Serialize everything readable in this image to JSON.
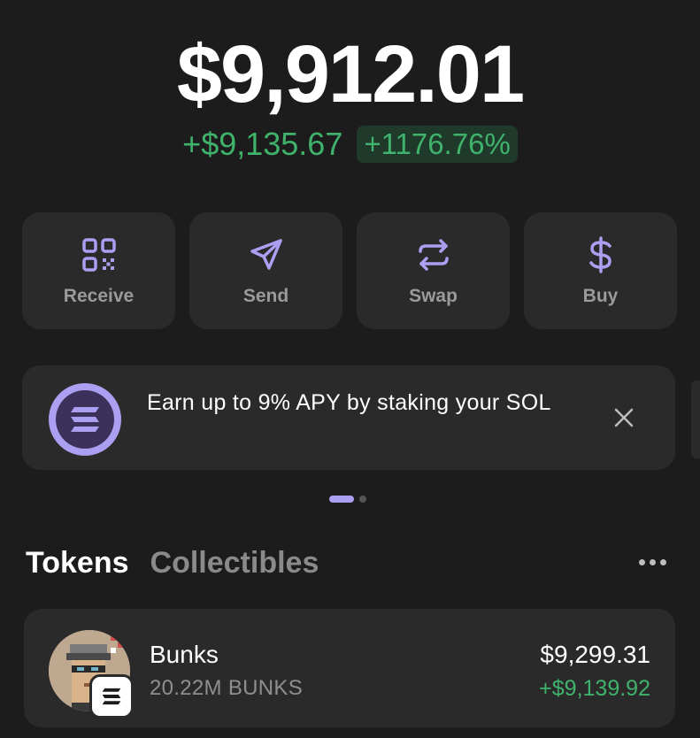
{
  "balance": {
    "total": "$9,912.01",
    "change_abs": "+$9,135.67",
    "change_pct": "+1176.76%"
  },
  "colors": {
    "background": "#1c1c1c",
    "card": "#2a2a2a",
    "accent": "#ab9ff2",
    "positive": "#3fb26c"
  },
  "actions": [
    {
      "label": "Receive",
      "icon": "qr-code-icon"
    },
    {
      "label": "Send",
      "icon": "paper-plane-icon"
    },
    {
      "label": "Swap",
      "icon": "swap-arrows-icon"
    },
    {
      "label": "Buy",
      "icon": "dollar-icon"
    }
  ],
  "banner": {
    "text": "Earn up to 9% APY by staking your SOL",
    "icon": "solana-logo-icon",
    "close_icon": "close-icon"
  },
  "carousel": {
    "pages": 2,
    "active": 1
  },
  "tabs": [
    {
      "label": "Tokens",
      "active": true
    },
    {
      "label": "Collectibles",
      "active": false
    }
  ],
  "tokens": [
    {
      "name": "Bunks",
      "amount": "20.22M BUNKS",
      "value": "$9,299.31",
      "change": "+$9,139.92",
      "avatar": "pixel-punk-avatar",
      "chain_badge": "solana-badge-icon"
    }
  ]
}
